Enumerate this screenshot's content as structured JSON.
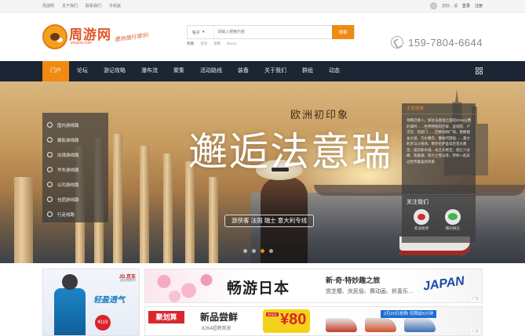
{
  "topbar": {
    "links": [
      "周游网",
      "关于我们",
      "联系我们",
      "手机版"
    ],
    "greeting": "您好，请",
    "login": "登录",
    "register": "注册"
  },
  "header": {
    "logo_name": "周游网",
    "logo_domain": "zouyou.com",
    "logo_slogan": "愿你旅行常乐!",
    "search": {
      "category": "帖子",
      "placeholder": "请输入搜索内容",
      "button": "搜索",
      "hot_label": "热搜",
      "hot_terms": [
        "活动",
        "攻略",
        "discuz"
      ]
    },
    "phone": "159-7804-6644"
  },
  "nav": {
    "items": [
      "门户",
      "论坛",
      "游记攻略",
      "瀑布流",
      "聚集",
      "活动路线",
      "装备",
      "关于我们",
      "群组",
      "动态"
    ],
    "active_index": 0
  },
  "banner": {
    "headline_sub": "欧洲初印象",
    "headline": "邂逅法意瑞",
    "route_tag": "游侠客 法国 瑞士 意大利专线",
    "slide_count": 4,
    "active_slide": 2,
    "route_menu": [
      "国内游线路",
      "摄影游线路",
      "出境游线路",
      "华东游线路",
      "公司游线路",
      "包团游线路",
      "行走线路"
    ],
    "side_panel": {
      "title": "主题旅游",
      "text": "领略巴黎人，探访法意瑞之旅的2015公费的满时……世界特别的巴黎、圣母院、卢浮宫、凯旋门……巴黎协和广场、香榭丽舍大道、凡尔赛宫、塞纳河游船……意大利罗马斗兽场、佛罗伦萨圣母百花大教堂、威尼斯水城、米兰大教堂，瑞士少女峰、琉森湖、铁力士雪山等，带你一起去过世界最美的风景",
      "follow_title": "关注我们",
      "follow": [
        {
          "icon": "weibo-icon",
          "label": "新浪微博"
        },
        {
          "icon": "wechat-icon",
          "label": "腾讯微信"
        }
      ]
    }
  },
  "ads": {
    "jd": {
      "logo": "JD.京东",
      "sub": "清仓购物节",
      "title": "轻盈透气",
      "price": "¥119"
    },
    "japan": {
      "title": "畅游日本",
      "tagline": "新·奇·特妙趣之旅",
      "desc": "赏芝樱、庆民俗、赛动画、祈喜乐…",
      "logo": "JAPAN",
      "tag": "广告"
    },
    "juhuasuan": {
      "logo": "聚划算",
      "title": "新品尝鲜",
      "sub": "8264超野首发",
      "sale_tag": "SALE",
      "sale_num": "¥80",
      "date": "2月20日抢购 仅限前5分钟",
      "tag": "广告"
    }
  }
}
